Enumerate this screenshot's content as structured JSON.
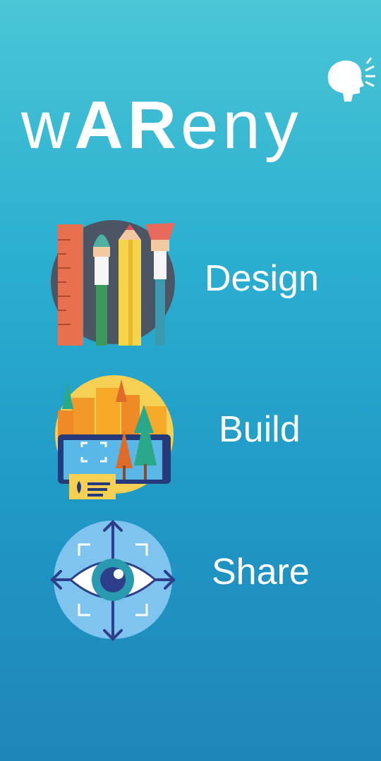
{
  "app": {
    "logo_text_parts": [
      "w",
      "A",
      "R",
      "eny"
    ]
  },
  "menu": {
    "items": [
      {
        "label": "Design",
        "icon": "art-tools-icon"
      },
      {
        "label": "Build",
        "icon": "city-ar-icon"
      },
      {
        "label": "Share",
        "icon": "eye-target-icon"
      }
    ]
  },
  "colors": {
    "background_top": "#4ac6d6",
    "background_bottom": "#1f86b8",
    "text": "#ffffff"
  }
}
